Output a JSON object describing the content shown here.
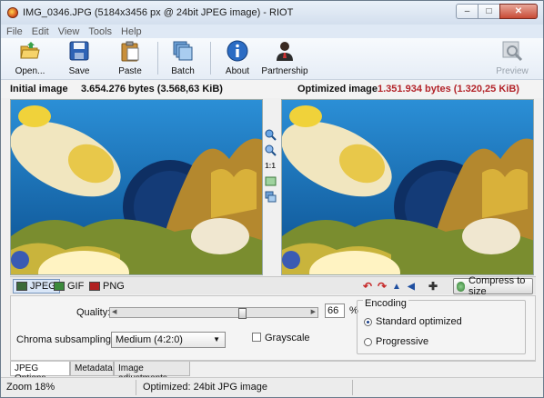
{
  "window": {
    "title": "IMG_0346.JPG (5184x3456 px @ 24bit JPEG image) - RIOT"
  },
  "menu": [
    "File",
    "Edit",
    "View",
    "Tools",
    "Help"
  ],
  "toolbar": {
    "open": "Open...",
    "save": "Save",
    "paste": "Paste",
    "batch": "Batch",
    "about": "About",
    "partnership": "Partnership",
    "preview": "Preview"
  },
  "initial": {
    "label": "Initial image",
    "size": "3.654.276 bytes (3.568,63 KiB)"
  },
  "optimized": {
    "label": "Optimized image",
    "size": "1.351.934 bytes (1.320,25 KiB)"
  },
  "middle_tools": {
    "actual_size": "1:1"
  },
  "formats": {
    "jpeg": "JPEG",
    "gif": "GIF",
    "png": "PNG",
    "active": "JPEG"
  },
  "compress": {
    "label": "Compress to size"
  },
  "options": {
    "quality_label": "Quality:",
    "quality_value": "66",
    "quality_unit": "%",
    "quality_fraction": 0.66,
    "chroma_label": "Chroma subsampling:",
    "chroma_value": "Medium (4:2:0)",
    "grayscale_label": "Grayscale",
    "grayscale_checked": false,
    "encoding_title": "Encoding",
    "encoding_standard": "Standard optimized",
    "encoding_progressive": "Progressive",
    "encoding_selected": "Standard optimized"
  },
  "tabs": [
    "JPEG Options",
    "Metadata",
    "Image adjustments"
  ],
  "status": {
    "zoom": "Zoom 18%",
    "message": "Optimized: 24bit JPG image"
  },
  "colors": {
    "optimized_size": "#b3242a",
    "active_tab": "#d9e6f7"
  }
}
